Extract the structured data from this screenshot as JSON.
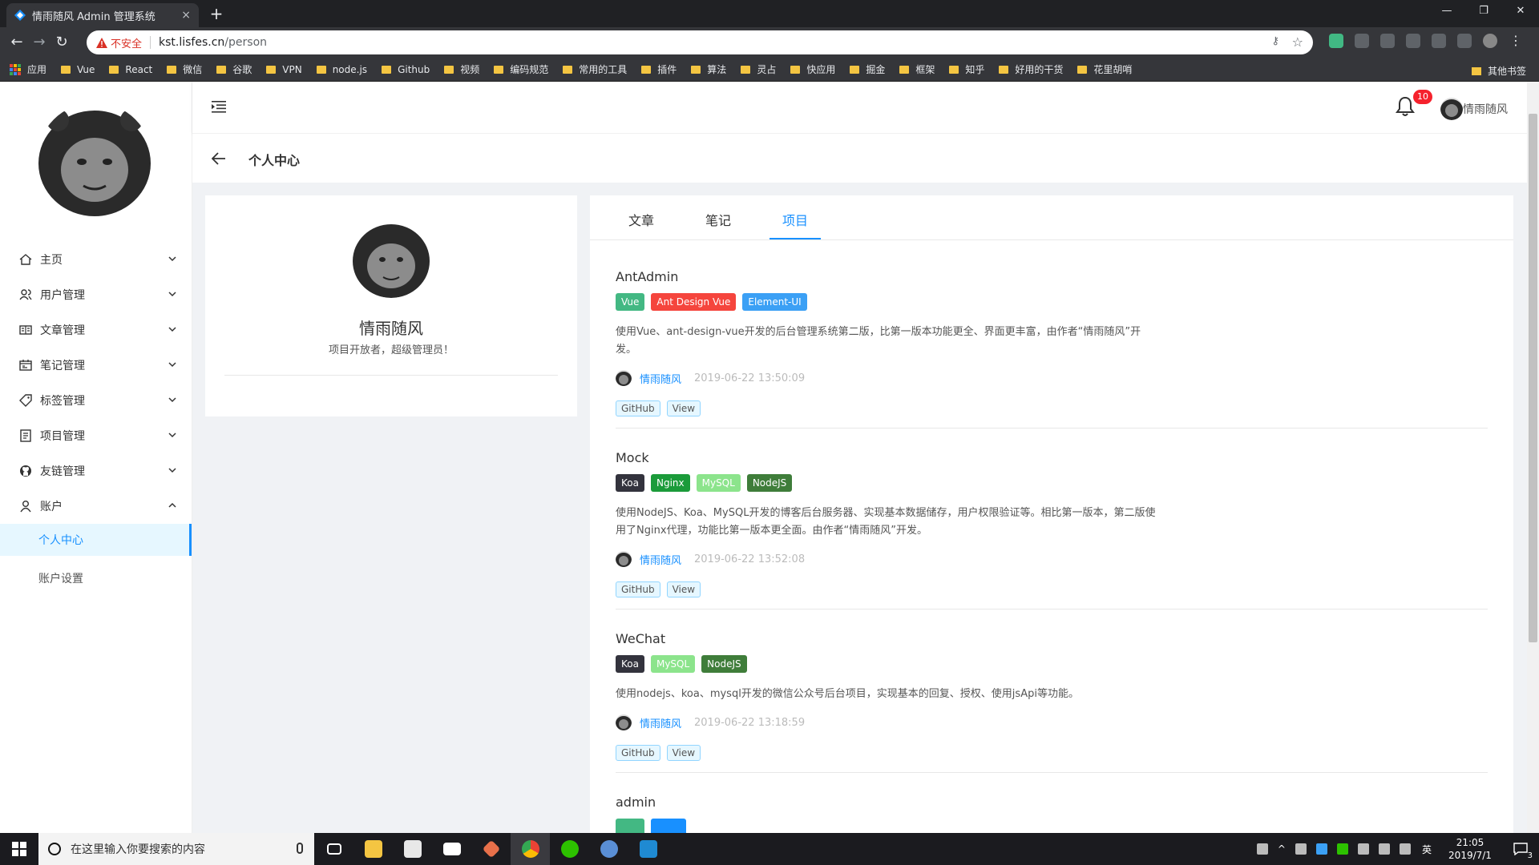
{
  "browser": {
    "tab_title": "情雨随风 Admin 管理系统",
    "tab_close": "×",
    "new_tab": "+",
    "security_text": "不安全",
    "url_host": "kst.lisfes.cn",
    "url_path": "/person",
    "bookmarks": [
      "应用",
      "Vue",
      "React",
      "微信",
      "谷歌",
      "VPN",
      "node.js",
      "Github",
      "视频",
      "编码规范",
      "常用的工具",
      "插件",
      "算法",
      "灵占",
      "快应用",
      "掘金",
      "框架",
      "知乎",
      "好用的干货",
      "花里胡哨"
    ],
    "bookmarks_other": "其他书签"
  },
  "sidebar": {
    "menu": [
      {
        "label": "主页",
        "icon": "home-icon"
      },
      {
        "label": "用户管理",
        "icon": "users-icon"
      },
      {
        "label": "文章管理",
        "icon": "book-icon"
      },
      {
        "label": "笔记管理",
        "icon": "calendar-icon"
      },
      {
        "label": "标签管理",
        "icon": "tag-icon"
      },
      {
        "label": "项目管理",
        "icon": "profile-icon"
      },
      {
        "label": "友链管理",
        "icon": "github-icon"
      },
      {
        "label": "账户",
        "icon": "user-icon"
      }
    ],
    "submenu": [
      {
        "label": "个人中心"
      },
      {
        "label": "账户设置"
      }
    ]
  },
  "header": {
    "notification_count": "10",
    "username": "情雨随风"
  },
  "page": {
    "title": "个人中心"
  },
  "profile": {
    "name": "情雨随风",
    "desc": "项目开放者，超级管理员！"
  },
  "tabs": [
    "文章",
    "笔记",
    "项目"
  ],
  "active_tab": "项目",
  "projects": [
    {
      "title": "AntAdmin",
      "tags": [
        {
          "label": "Vue",
          "color": "#43b883"
        },
        {
          "label": "Ant Design Vue",
          "color": "#f5453d"
        },
        {
          "label": "Element-UI",
          "color": "#3ba0f5"
        }
      ],
      "desc_lines": [
        "使用Vue、ant-design-vue开发的后台管理系统第二版，比第一版本功能更全、界面更丰富，由作者“情雨随风”开",
        "发。"
      ],
      "author": "情雨随风",
      "date": "2019-06-22 13:50:09",
      "buttons": [
        "GitHub",
        "View"
      ]
    },
    {
      "title": "Mock",
      "tags": [
        {
          "label": "Koa",
          "color": "#33333d"
        },
        {
          "label": "Nginx",
          "color": "#1b9b3a"
        },
        {
          "label": "MySQL",
          "color": "#8ce48c"
        },
        {
          "label": "NodeJS",
          "color": "#3f7d3a"
        }
      ],
      "desc_lines": [
        "使用NodeJS、Koa、MySQL开发的博客后台服务器、实现基本数据储存，用户权限验证等。相比第一版本，第二版使",
        "用了Nginx代理，功能比第一版本更全面。由作者“情雨随风”开发。"
      ],
      "author": "情雨随风",
      "date": "2019-06-22 13:52:08",
      "buttons": [
        "GitHub",
        "View"
      ]
    },
    {
      "title": "WeChat",
      "tags": [
        {
          "label": "Koa",
          "color": "#33333d"
        },
        {
          "label": "MySQL",
          "color": "#8ce48c"
        },
        {
          "label": "NodeJS",
          "color": "#3f7d3a"
        }
      ],
      "desc_lines": [
        "使用nodejs、koa、mysql开发的微信公众号后台项目，实现基本的回复、授权、使用jsApi等功能。"
      ],
      "author": "情雨随风",
      "date": "2019-06-22 13:18:59",
      "buttons": [
        "GitHub",
        "View"
      ]
    },
    {
      "title": "admin"
    }
  ],
  "taskbar": {
    "search_placeholder": "在这里输入你要搜索的内容",
    "ime": "英",
    "time": "21:05",
    "date": "2019/7/1",
    "notif_count": "3"
  }
}
